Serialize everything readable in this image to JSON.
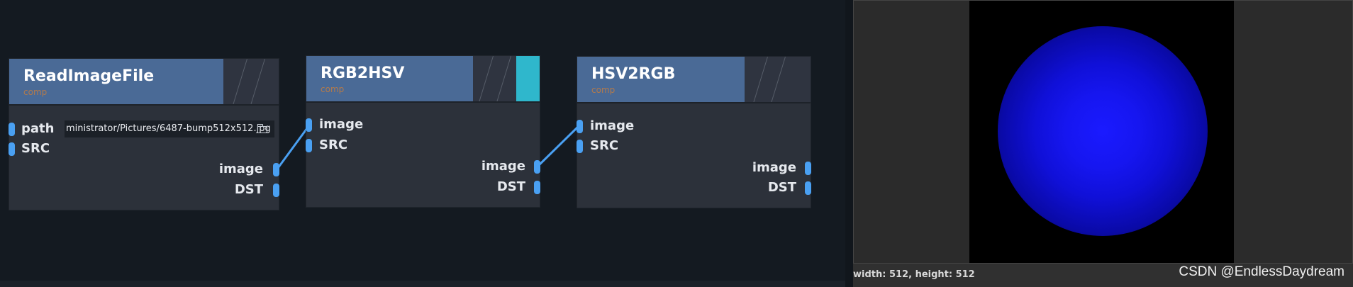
{
  "nodes": {
    "read": {
      "title": "ReadImageFile",
      "subtitle": "comp",
      "inputs": [
        "path",
        "SRC"
      ],
      "outputs": [
        "image",
        "DST"
      ],
      "path_value": "ministrator/Pictures/6487-bump512x512.jpg"
    },
    "rgb2hsv": {
      "title": "RGB2HSV",
      "subtitle": "comp",
      "inputs": [
        "image",
        "SRC"
      ],
      "outputs": [
        "image",
        "DST"
      ]
    },
    "hsv2rgb": {
      "title": "HSV2RGB",
      "subtitle": "comp",
      "inputs": [
        "image",
        "SRC"
      ],
      "outputs": [
        "image",
        "DST"
      ]
    }
  },
  "preview": {
    "dimensions": "width: 512, height: 512"
  },
  "watermark": "CSDN @EndlessDaydream",
  "colors": {
    "canvas_bg": "#141a21",
    "node_header": "#4a6a96",
    "node_body": "#2c313a",
    "port": "#4aa0f2",
    "wire": "#4aa0f2",
    "accent": "#2fb7cc"
  }
}
